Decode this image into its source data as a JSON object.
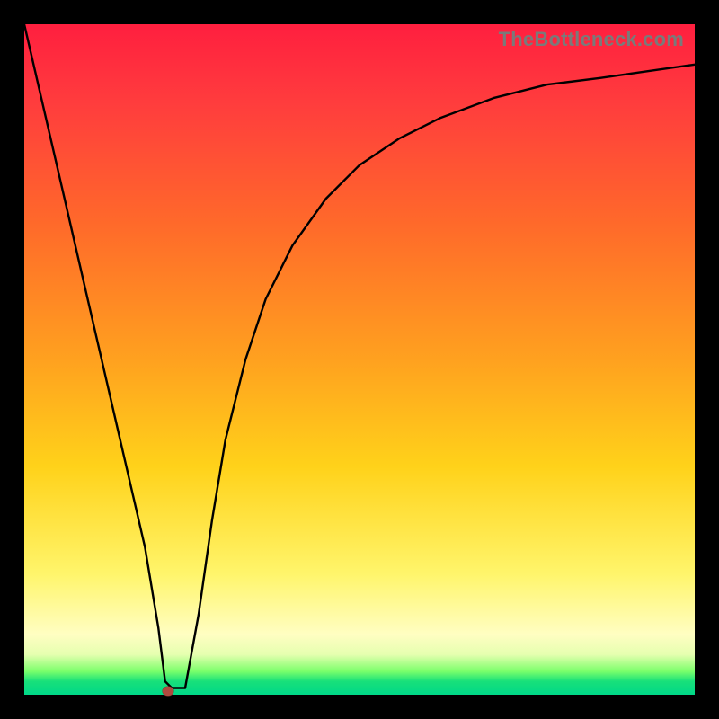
{
  "watermark": "TheBottleneck.com",
  "colors": {
    "frame": "#000000",
    "gradient_top": "#ff1f3f",
    "gradient_mid1": "#ff6a2a",
    "gradient_mid2": "#ffd21a",
    "gradient_mid3": "#fffec2",
    "gradient_bottom": "#00d888",
    "curve": "#000000",
    "marker": "#b0493f"
  },
  "chart_data": {
    "type": "line",
    "title": "",
    "xlabel": "",
    "ylabel": "",
    "xlim": [
      0,
      100
    ],
    "ylim": [
      0,
      100
    ],
    "grid": false,
    "legend": false,
    "series": [
      {
        "name": "curve",
        "x": [
          0,
          3,
          6,
          9,
          12,
          15,
          18,
          20,
          21,
          22,
          24,
          26,
          28,
          30,
          33,
          36,
          40,
          45,
          50,
          56,
          62,
          70,
          78,
          86,
          93,
          100
        ],
        "y": [
          100,
          87,
          74,
          61,
          48,
          35,
          22,
          10,
          2,
          1,
          1,
          12,
          26,
          38,
          50,
          59,
          67,
          74,
          79,
          83,
          86,
          89,
          91,
          92,
          93,
          94
        ]
      }
    ],
    "marker": {
      "x": 21.5,
      "y": 0.5
    },
    "notes": "x and y are normalized 0–100; y=0 is bottom of plot, y=100 is top. Values estimated from pixel positions."
  }
}
